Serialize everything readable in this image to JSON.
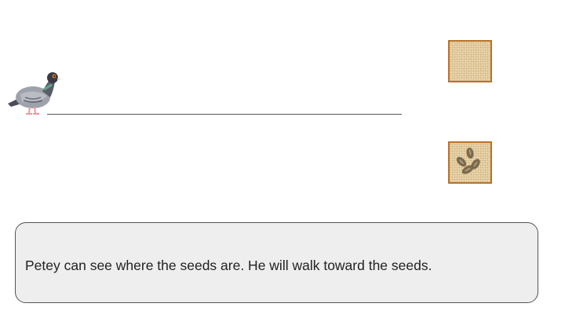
{
  "scene": {
    "character": {
      "name": "Petey",
      "icon": "pigeon-icon"
    },
    "tiles": [
      {
        "id": "empty",
        "icon": "blank-burlap-tile"
      },
      {
        "id": "seeds",
        "icon": "seeds-icon"
      }
    ]
  },
  "caption": {
    "text": "Petey can see where the seeds are. He will walk toward the seeds."
  },
  "colors": {
    "tile_border": "#b8742a",
    "tile_fill": "#e8d2a6",
    "seed": "#7a6a4a",
    "caption_bg": "#eeeeee",
    "pigeon_body": "#9a9ea6",
    "pigeon_head": "#3a3a44",
    "pigeon_eye": "#e07a20"
  }
}
